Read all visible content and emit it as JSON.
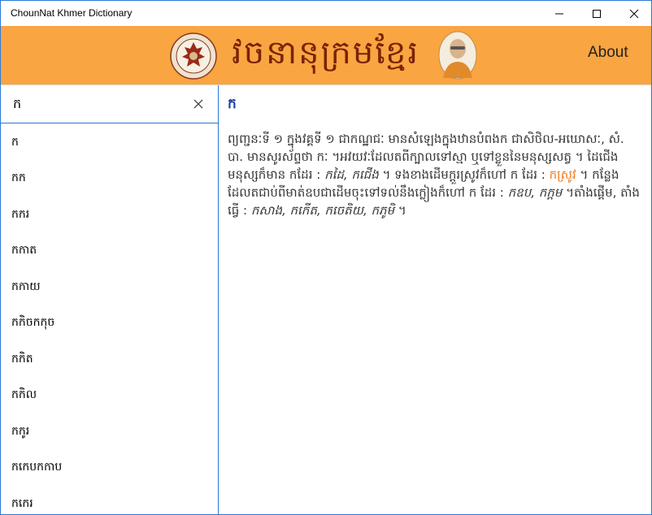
{
  "window": {
    "title": "ChounNat Khmer Dictionary",
    "accent": "#2b79d6"
  },
  "header": {
    "brand_text": "វចនានុក្រមខ្មែរ",
    "about_label": "About",
    "background": "#f9a541"
  },
  "search": {
    "value": "ក"
  },
  "word_list": [
    "ក",
    "កក",
    "កករ",
    "កកាត",
    "កកាយ",
    "កកិចកកុច",
    "កកិត",
    "កកិល",
    "កកូរ",
    "កកេបកកាប",
    "កកេរ"
  ],
  "entry": {
    "headword": "ក",
    "def_1": "ព្យញ្ជនៈទី ១ ក្នុងវគ្គទី ១ ជាកណ្ឋជៈ មានសំឡេងក្នុងឋានបំពងក ជាសិថិល-អឃោសៈ, សំ. បា. មានសូរស័ព្ទថា កៈ ។អវយវៈដែលតពីក្បាលទៅស្មា ឬទៅខ្លួននៃមនុស្សសត្វ ។ ដៃជើងមនុស្សក៏មាន កដែរ :",
    "def_2": "កដៃ, កជើង",
    "def_3": "។ ទងខាងដើមក្ដួរស្រូវក៏ហៅ ក ដែរ :",
    "def_link": "កស្រូវ",
    "def_4": "។ កន្លែងដែលតជាប់ពីមាត់ឧបជាដើមចុះទៅទល់នឹងក្លៀងក៏ហៅ ក ដែរ :",
    "def_5": "កឧប, កក្ដម",
    "def_6": "។តាំងផ្ដើម, តាំងធ្វើ :",
    "def_7": "កសាង, កកើត, កចេតិយ, កភូមិ",
    "def_8": "។",
    "link_color": "#f07a1c",
    "headword_color": "#1d3fa6"
  }
}
